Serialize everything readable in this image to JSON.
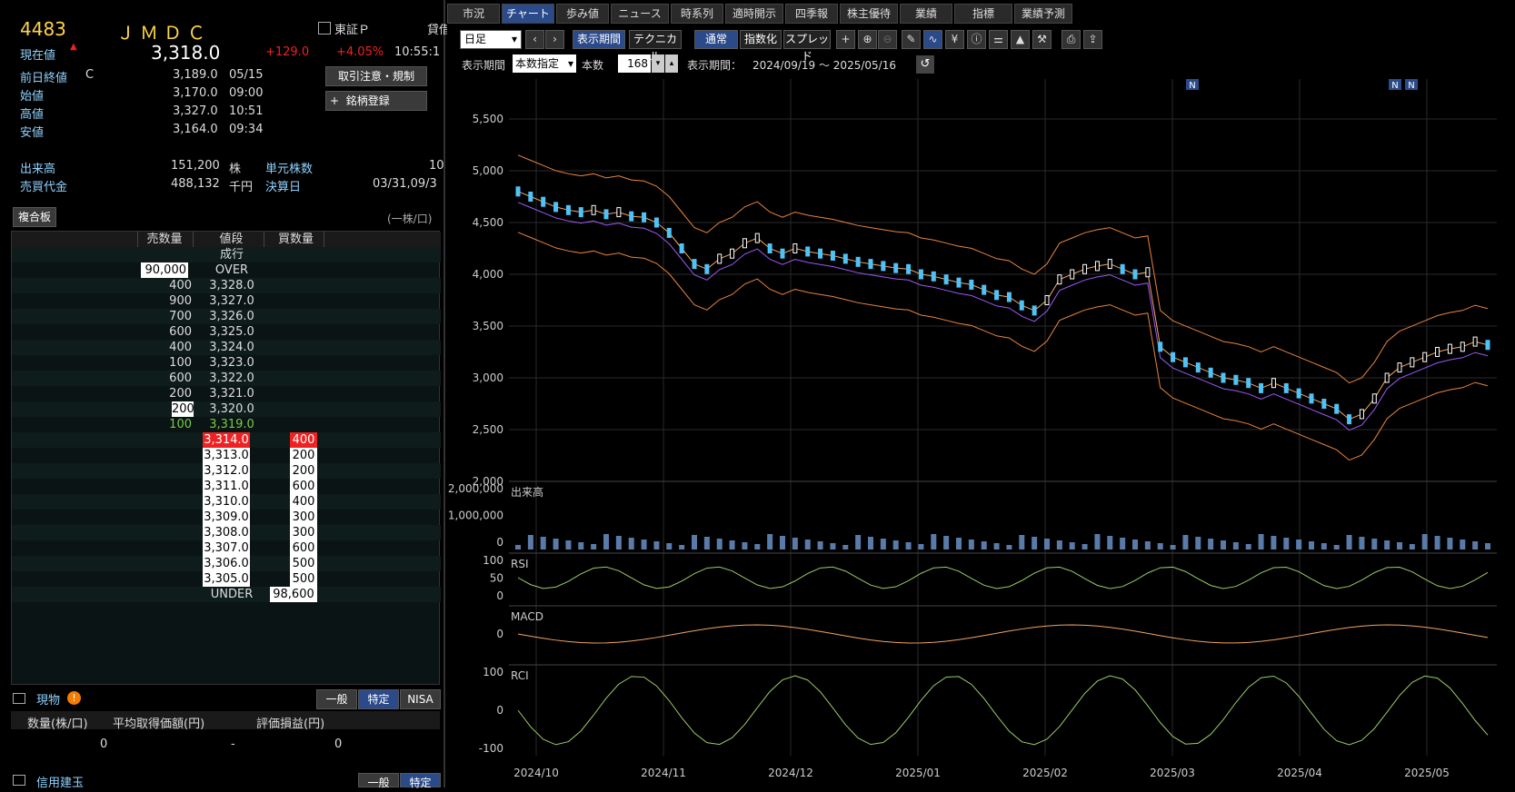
{
  "quote": {
    "code": "4483",
    "name": "ＪＭＤＣ",
    "market": "東証Ｐ",
    "market_extra": "貸借",
    "current_label": "現在値",
    "current_value": "3,318.0",
    "change": "+129.0",
    "change_pct": "+4.05%",
    "time": "10:55:1",
    "prev_close_label": "前日終値",
    "prev_close_flag": "C",
    "prev_close": "3,189.0",
    "prev_close_date": "05/15",
    "open_label": "始値",
    "open": "3,170.0",
    "open_time": "09:00",
    "high_label": "高値",
    "high": "3,327.0",
    "high_time": "10:51",
    "low_label": "安値",
    "low": "3,164.0",
    "low_time": "09:34",
    "volume_label": "出来高",
    "volume": "151,200",
    "volume_unit": "株",
    "unit_label": "単元株数",
    "unit": "10",
    "turnover_label": "売買代金",
    "turnover": "488,132",
    "turnover_unit": "千円",
    "settle_label": "決算日",
    "settle": "03/31,09/3",
    "btn_rules": "取引注意・規制",
    "btn_register": "銘柄登録",
    "btn_register_icon": "+"
  },
  "board": {
    "title": "複合板",
    "unit_note": "(一株/口)",
    "headers": [
      "売数量",
      "値段",
      "買数量"
    ],
    "rows": [
      {
        "sell": "",
        "price": "成行",
        "buy": ""
      },
      {
        "sell": "90,000",
        "price": "OVER",
        "buy": ""
      },
      {
        "sell": "400",
        "price": "3,328.0",
        "buy": ""
      },
      {
        "sell": "900",
        "price": "3,327.0",
        "buy": ""
      },
      {
        "sell": "700",
        "price": "3,326.0",
        "buy": ""
      },
      {
        "sell": "600",
        "price": "3,325.0",
        "buy": ""
      },
      {
        "sell": "400",
        "price": "3,324.0",
        "buy": ""
      },
      {
        "sell": "100",
        "price": "3,323.0",
        "buy": ""
      },
      {
        "sell": "600",
        "price": "3,322.0",
        "buy": ""
      },
      {
        "sell": "200",
        "price": "3,321.0",
        "buy": ""
      },
      {
        "sell": "200",
        "price": "3,320.0",
        "buy": ""
      },
      {
        "sell": "100",
        "price": "3,319.0",
        "buy": ""
      },
      {
        "sell": "",
        "price": "3,314.0",
        "buy": "400"
      },
      {
        "sell": "",
        "price": "3,313.0",
        "buy": "200"
      },
      {
        "sell": "",
        "price": "3,312.0",
        "buy": "200"
      },
      {
        "sell": "",
        "price": "3,311.0",
        "buy": "600"
      },
      {
        "sell": "",
        "price": "3,310.0",
        "buy": "400"
      },
      {
        "sell": "",
        "price": "3,309.0",
        "buy": "300"
      },
      {
        "sell": "",
        "price": "3,308.0",
        "buy": "300"
      },
      {
        "sell": "",
        "price": "3,307.0",
        "buy": "600"
      },
      {
        "sell": "",
        "price": "3,306.0",
        "buy": "500"
      },
      {
        "sell": "",
        "price": "3,305.0",
        "buy": "500"
      },
      {
        "sell": "",
        "price": "UNDER",
        "buy": "98,600"
      }
    ]
  },
  "holdings": {
    "title": "現物",
    "tabs": [
      "一般",
      "特定",
      "NISA"
    ],
    "headers": [
      "数量(株/口)",
      "平均取得価額(円)",
      "評価損益(円)"
    ],
    "values": [
      "0",
      "-",
      "0"
    ],
    "credit_title": "信用建玉",
    "credit_tabs": [
      "一般",
      "特定"
    ]
  },
  "tabs": [
    "市況",
    "チャート",
    "歩み値",
    "ニュース",
    "時系列",
    "適時開示",
    "四季報",
    "株主優待",
    "業績",
    "指標",
    "業績予測"
  ],
  "toolbar": {
    "period_select": "日足",
    "display_period": "表示期間",
    "technical": "テクニカル",
    "normal": "通常",
    "index": "指数化",
    "spread": "スプレッド",
    "period_label": "表示期間",
    "period_mode": "本数指定",
    "count_label": "本数",
    "count": "168",
    "range_label": "表示期間：",
    "range": "2024/09/19 ～ 2025/05/16"
  },
  "chart_data": {
    "type": "candlestick",
    "price_axis": [
      "5,500",
      "5,000",
      "4,500",
      "4,000",
      "3,500",
      "3,000",
      "2,500",
      "2,000"
    ],
    "volume_axis": [
      "2,000,000",
      "1,000,000",
      "0"
    ],
    "volume_label": "出来高",
    "rsi_label": "RSI",
    "rsi_axis": [
      "100",
      "50",
      "0"
    ],
    "macd_label": "MACD",
    "macd_axis": [
      "0"
    ],
    "rci_label": "RCI",
    "rci_axis": [
      "100",
      "0",
      "-100"
    ],
    "x_labels": [
      "2024/10",
      "2024/11",
      "2024/12",
      "2025/01",
      "2025/02",
      "2025/03",
      "2025/04",
      "2025/05"
    ],
    "news_marker": "N",
    "closes": [
      4800,
      4750,
      4700,
      4650,
      4620,
      4600,
      4620,
      4580,
      4600,
      4560,
      4550,
      4500,
      4400,
      4250,
      4100,
      4050,
      4150,
      4200,
      4300,
      4350,
      4250,
      4200,
      4250,
      4220,
      4200,
      4180,
      4150,
      4120,
      4100,
      4080,
      4060,
      4050,
      4000,
      3980,
      3950,
      3920,
      3900,
      3850,
      3800,
      3780,
      3700,
      3650,
      3750,
      3950,
      4000,
      4050,
      4080,
      4100,
      4050,
      4000,
      4020,
      3300,
      3200,
      3150,
      3100,
      3050,
      3000,
      2980,
      2950,
      2900,
      2950,
      2900,
      2850,
      2800,
      2750,
      2700,
      2600,
      2650,
      2800,
      3000,
      3100,
      3150,
      3200,
      3250,
      3280,
      3300,
      3350,
      3318
    ]
  },
  "colors": {
    "accent": "#2b4a8a",
    "up": "#e22",
    "down": "#4fc3f7",
    "label": "#8fd3ff",
    "code": "#ffd54a"
  }
}
